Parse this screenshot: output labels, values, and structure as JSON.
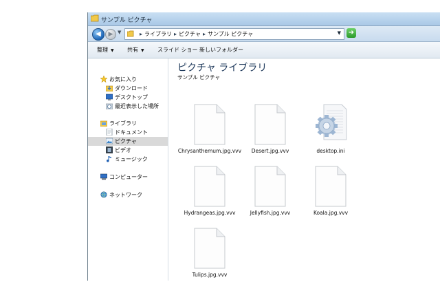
{
  "window": {
    "title": "サンプル ピクチャ"
  },
  "address": {
    "crumbs": [
      "ライブラリ",
      "ピクチャ",
      "サンプル ピクチャ"
    ]
  },
  "toolbar": {
    "organize": "整理",
    "share": "共有",
    "slideshow": "スライド ショー",
    "new_folder": "新しいフォルダー"
  },
  "nav": {
    "favorites": "お気に入り",
    "downloads": "ダウンロード",
    "desktop": "デスクトップ",
    "recent": "最近表示した場所",
    "libraries": "ライブラリ",
    "documents": "ドキュメント",
    "pictures": "ピクチャ",
    "videos": "ビデオ",
    "music": "ミュージック",
    "computer": "コンピューター",
    "network": "ネットワーク"
  },
  "content": {
    "library_title": "ピクチャ ライブラリ",
    "library_subtitle": "サンプル ピクチャ",
    "files": [
      {
        "name": "Chrysanthemum.jpg.vvv",
        "icon": "blank-document-icon"
      },
      {
        "name": "Desert.jpg.vvv",
        "icon": "blank-document-icon"
      },
      {
        "name": "desktop.ini",
        "icon": "settings-file-icon"
      },
      {
        "name": "Hydrangeas.jpg.vvv",
        "icon": "blank-document-icon"
      },
      {
        "name": "Jellyfish.jpg.vvv",
        "icon": "blank-document-icon"
      },
      {
        "name": "Koala.jpg.vvv",
        "icon": "blank-document-icon"
      },
      {
        "name": "Tulips.jpg.vvv",
        "icon": "blank-document-icon"
      }
    ]
  },
  "colors": {
    "titlebar": "#b9d3ec",
    "selection": "#d9d9d9",
    "library_title": "#1e395b"
  }
}
